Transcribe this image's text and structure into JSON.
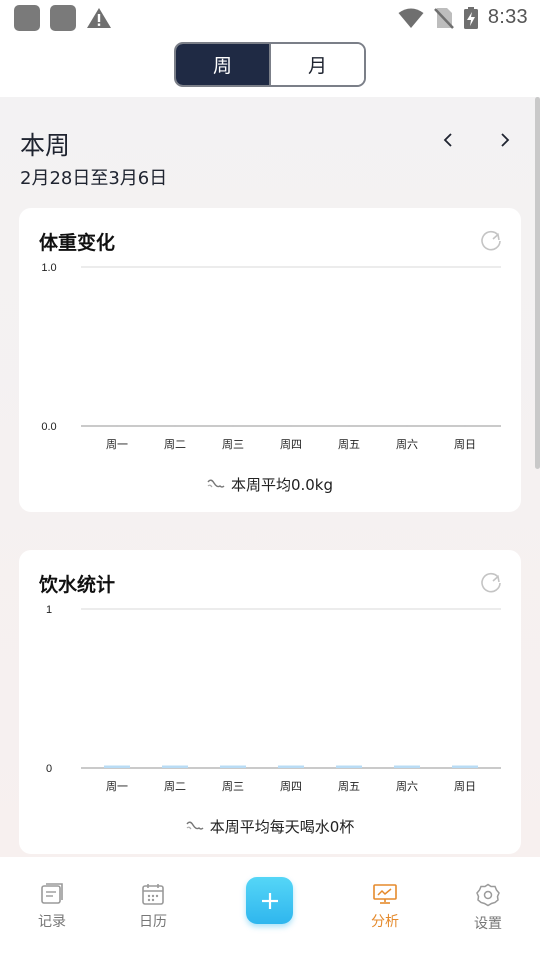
{
  "status_bar": {
    "time": "8:33",
    "icons": [
      "app-icon",
      "app-icon",
      "warning-icon",
      "wifi-icon",
      "no-sim-icon",
      "battery-charging-icon"
    ]
  },
  "toggle": {
    "week_label": "周",
    "month_label": "月",
    "selected": "周"
  },
  "period": {
    "title": "本周",
    "range": "2月28日至3月6日",
    "prev_icon": "chevron-left-icon",
    "next_icon": "chevron-right-icon"
  },
  "weight_card": {
    "title": "体重变化",
    "average_text": "本周平均0.0kg",
    "icon": "refresh-icon"
  },
  "water_card": {
    "title": "饮水统计",
    "average_text": "本周平均每天喝水0杯",
    "icon": "refresh-icon"
  },
  "chart_data": [
    {
      "type": "line",
      "categories": [
        "周一",
        "周二",
        "周三",
        "周四",
        "周五",
        "周六",
        "周日"
      ],
      "series": [
        {
          "values": [
            0,
            0,
            0,
            0,
            0,
            0,
            0
          ]
        }
      ],
      "ylim": [
        0.0,
        1.0
      ],
      "yticks": [
        "0.0",
        "1.0"
      ],
      "grid": true,
      "color": "#3b8fe6"
    },
    {
      "type": "bar",
      "categories": [
        "周一",
        "周二",
        "周三",
        "周四",
        "周五",
        "周六",
        "周日"
      ],
      "series": [
        {
          "values": [
            0,
            0,
            0,
            0,
            0,
            0,
            0
          ]
        }
      ],
      "ylim": [
        0,
        1
      ],
      "yticks": [
        "0",
        "1"
      ],
      "grid": true,
      "color": "#b9dcf5"
    }
  ],
  "bottom_nav": {
    "items": [
      {
        "label": "记录",
        "icon": "notebook-icon"
      },
      {
        "label": "日历",
        "icon": "calendar-icon"
      },
      {
        "label": "分析",
        "icon": "presentation-chart-icon"
      },
      {
        "label": "设置",
        "icon": "settings-icon"
      }
    ],
    "active": "分析",
    "add_icon": "plus-icon"
  },
  "colors": {
    "accent": "#1f2a44",
    "active_tab": "#e58a2c",
    "fab": "#2fb6ee"
  }
}
